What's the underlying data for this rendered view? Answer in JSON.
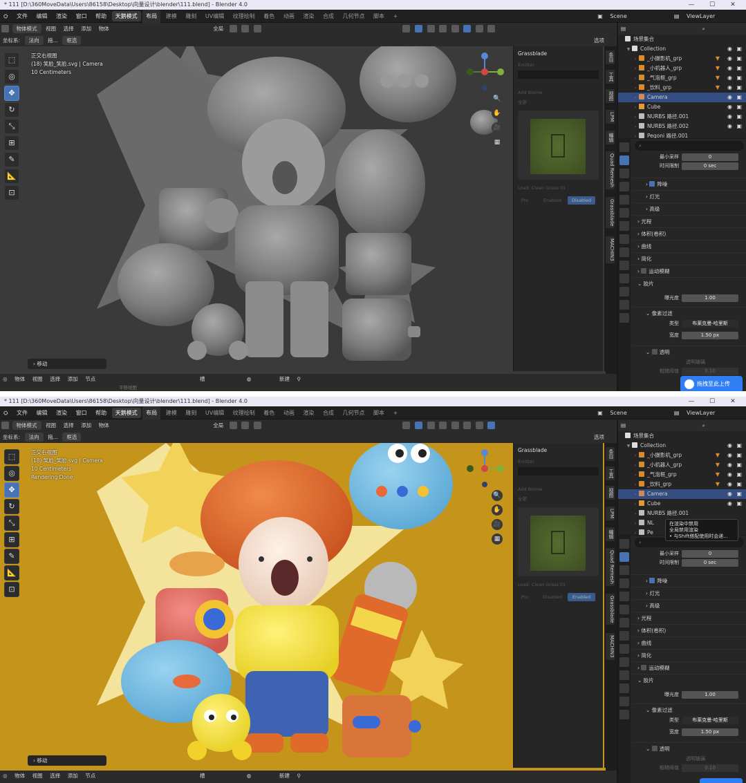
{
  "titlebar": {
    "text": "* 111 [D:\\360MoveData\\Users\\86158\\Desktop\\向量设计\\blender\\111.blend] - Blender 4.0",
    "buttons": [
      "—",
      "☐",
      "✕"
    ]
  },
  "menu": {
    "items": [
      "文件",
      "编辑",
      "渲染",
      "窗口",
      "帮助"
    ],
    "mode": "天鹅模式",
    "workspaces": [
      "布局",
      "建模",
      "雕刻",
      "UV编辑",
      "纹理绘制",
      "着色",
      "动画",
      "渲染",
      "合成",
      "几何节点",
      "脚本",
      "+"
    ],
    "scene": "Scene",
    "view_layer": "ViewLayer"
  },
  "header": {
    "mode_select": "物体模式",
    "menu": [
      "视图",
      "选择",
      "添加",
      "物体"
    ],
    "orientation_label": "坐标系:",
    "orientation_value": "法向",
    "drag_label": "拖...",
    "select_box": "框选",
    "transform_space": "全局",
    "options_label": "选项"
  },
  "viewport_info": {
    "view_name": "正交右视图",
    "object_name": "(18) 笑脸_笑脸.svg | Camera",
    "scale": "10 Centimeters",
    "render_status": "Rendering Done"
  },
  "operator_panel": "移动",
  "tools": [
    "⬚",
    "◎",
    "✥",
    "↻",
    "⤡",
    "⊞",
    "✎",
    "📐",
    "⊡"
  ],
  "gizmo": {
    "x": "X",
    "y": "Y",
    "z": "Z"
  },
  "nav_icons": [
    "🔍",
    "✋",
    "🎥",
    "▦"
  ],
  "npanel": {
    "title": "Grassblade",
    "field_label": "Emitter",
    "add_biome_label": "Add Biome",
    "all_label": "全部",
    "load_label": "Load: Clean Grass 01",
    "pro_label": "Pro",
    "enabled_label": "Enabled",
    "disabled_label": "Disabled",
    "vtabs": [
      "条目",
      "工具",
      "视图",
      "LPM",
      "编辑",
      "Quad Remesh",
      "Grassblade",
      "MACHIN3"
    ]
  },
  "outliner": {
    "scene_collection": "场景集合",
    "collection": "Collection",
    "items": [
      {
        "name": "_小摄影机_grp",
        "selected": false,
        "color": "#d68b2d"
      },
      {
        "name": "_小机器人_grp",
        "selected": false,
        "color": "#d68b2d"
      },
      {
        "name": "_气泡框_grp",
        "selected": false,
        "color": "#d68b2d"
      },
      {
        "name": "_饮料_grp",
        "selected": false,
        "color": "#d68b2d"
      },
      {
        "name": "Camera",
        "selected": true,
        "color": "#ce8c5c"
      },
      {
        "name": "Cube",
        "selected": false,
        "color": "#e09a3a"
      },
      {
        "name": "NURBS 路径.001",
        "selected": false,
        "color": "#bdbdbd"
      },
      {
        "name": "NURBS 路径.002",
        "selected": false,
        "color": "#bdbdbd"
      },
      {
        "name": "Pegoni 路径.001",
        "selected": false,
        "color": "#bdbdbd"
      }
    ],
    "items_bottom": [
      {
        "name": "_小摄影机_grp",
        "selected": false,
        "color": "#d68b2d"
      },
      {
        "name": "_小机器人_grp",
        "selected": false,
        "color": "#d68b2d"
      },
      {
        "name": "_气泡框_grp",
        "selected": false,
        "color": "#d68b2d"
      },
      {
        "name": "_饮料_grp",
        "selected": false,
        "color": "#d68b2d"
      },
      {
        "name": "Camera",
        "selected": true,
        "color": "#ce8c5c"
      },
      {
        "name": "Cube",
        "selected": false,
        "color": "#e09a3a"
      },
      {
        "name": "NURBS 路径.001",
        "selected": false,
        "color": "#bdbdbd"
      },
      {
        "name": "NL",
        "selected": false,
        "color": "#bdbdbd"
      },
      {
        "name": "Pe",
        "selected": false,
        "color": "#bdbdbd"
      }
    ]
  },
  "properties": {
    "min_samples_label": "最小采样",
    "min_samples_value": "0",
    "time_limit_label": "时间限制",
    "time_limit_value": "0 sec",
    "sections": [
      "降噪",
      "灯光",
      "高级",
      "光程",
      "体积(卷积)",
      "曲线",
      "简化",
      "运动模糊",
      "胶片"
    ],
    "exposure_label": "曝光度",
    "exposure_value": "1.00",
    "pixel_filter": "像素过滤",
    "type_label": "类型",
    "type_value": "布莱克曼-哈里斯",
    "width_label": "宽度",
    "width_value": "1.50 px",
    "transparent": "透明",
    "transparent_glass": "透明玻璃",
    "roughness_label": "粗糙阈值",
    "roughness_value": "0.10"
  },
  "status": {
    "mode_select": "物体",
    "menu": [
      "视图",
      "选择",
      "添加",
      "节点"
    ],
    "slot": "槽",
    "new_label": "新建",
    "hint_bottom": "平移视图"
  },
  "tooltip": {
    "line1": "在渲染中禁用",
    "line2": "全局禁用渲染",
    "line3": "• 与Shift搭配使用时会递..."
  },
  "upload": "拖拽至此上传",
  "colors": {
    "accent": "#4772b3",
    "viewport_top_bg": "#3a3a3a",
    "viewport_bottom_bg": "#c5951b",
    "selection": "#334d80"
  }
}
